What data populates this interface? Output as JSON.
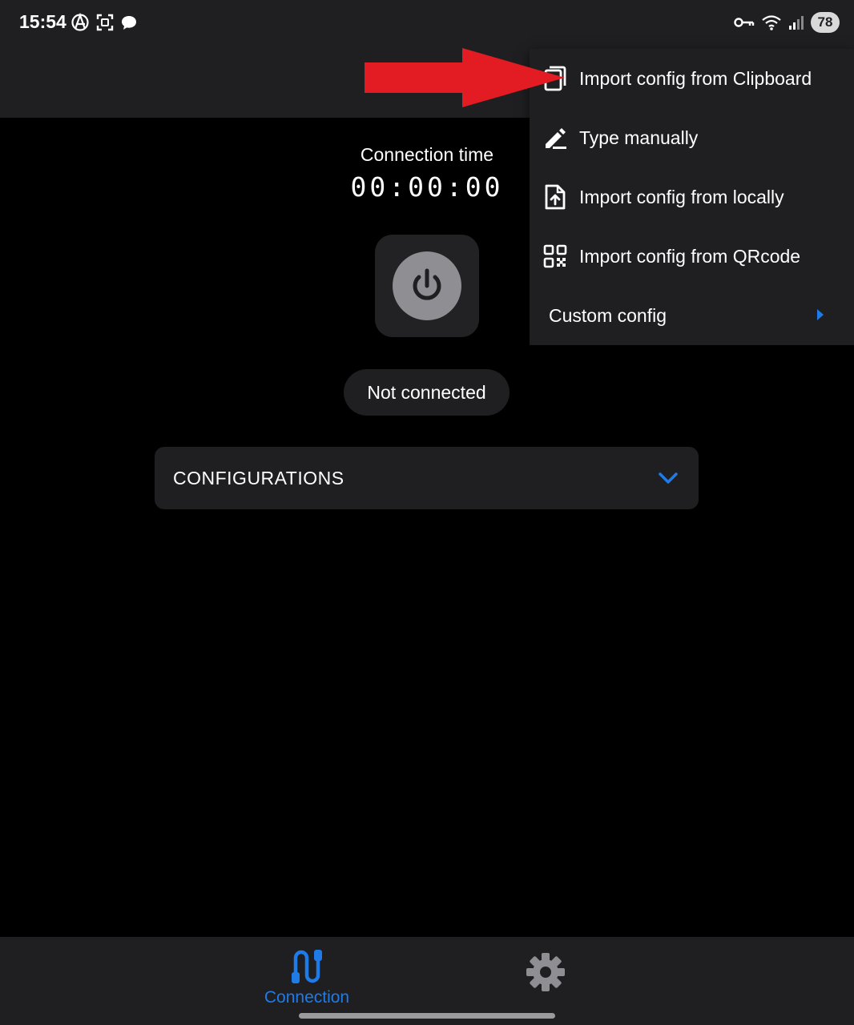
{
  "status_bar": {
    "time": "15:54",
    "battery": "78",
    "left_icons": [
      "anarchy-icon",
      "screenshot-icon",
      "chat-bubble-icon"
    ],
    "right_icons": [
      "vpn-key-icon",
      "wifi-icon",
      "signal-icon"
    ]
  },
  "connection": {
    "label": "Connection time",
    "timer": "00:00:00",
    "status": "Not connected"
  },
  "configurations": {
    "label": "CONFIGURATIONS"
  },
  "menu": {
    "items": [
      {
        "label": "Import config from Clipboard",
        "icon": "clipboard-icon"
      },
      {
        "label": "Type manually",
        "icon": "edit-pen-icon"
      },
      {
        "label": "Import config from locally",
        "icon": "file-upload-icon"
      },
      {
        "label": "Import config from QRcode",
        "icon": "qrcode-icon"
      },
      {
        "label": "Custom config",
        "icon": "chevron-right-icon"
      }
    ]
  },
  "bottom_nav": {
    "connection_label": "Connection"
  },
  "colors": {
    "accent": "#1e7be8",
    "surface": "#1f1f21",
    "background": "#000000",
    "annotation_arrow": "#e31c23"
  }
}
